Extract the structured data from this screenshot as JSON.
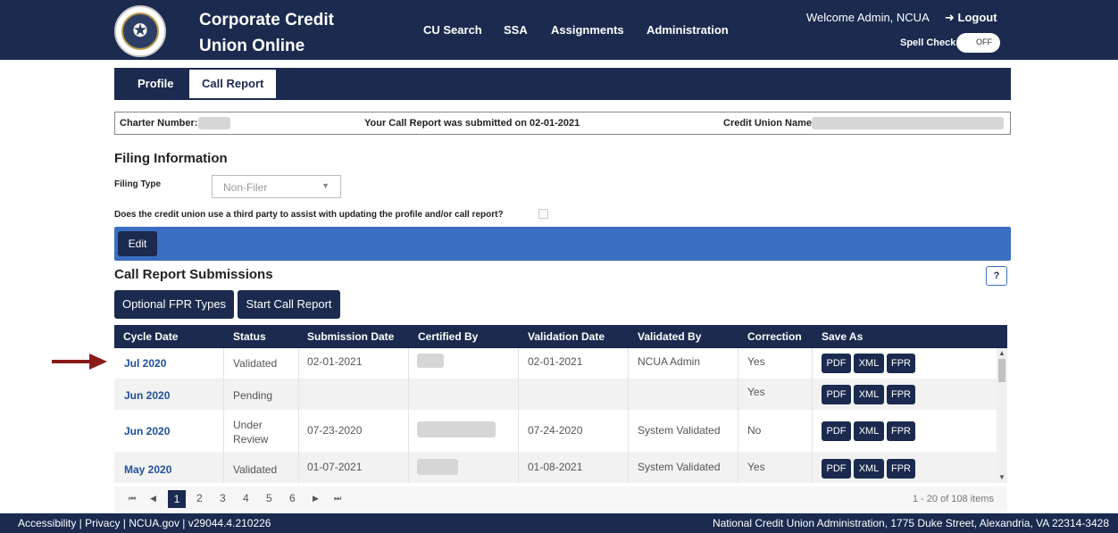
{
  "header": {
    "title_line1": "Corporate Credit",
    "title_line2": "Union Online",
    "nav": [
      "CU Search",
      "SSA",
      "Assignments",
      "Administration"
    ],
    "welcome": "Welcome Admin, NCUA",
    "logout": "Logout",
    "spell_check_label": "Spell Check",
    "spell_check_state": "OFF"
  },
  "tabs": [
    "Profile",
    "Call Report"
  ],
  "info": {
    "charter_label": "Charter Number:",
    "submitted_text": "Your Call Report was submitted on 02-01-2021",
    "cu_name_label": "Credit Union Name:"
  },
  "filing": {
    "heading": "Filing Information",
    "type_label": "Filing Type",
    "type_value": "Non-Filer",
    "third_party_question": "Does the credit union use a third party to assist with updating the profile and/or call report?",
    "edit_label": "Edit"
  },
  "submissions": {
    "heading": "Call Report Submissions",
    "help_label": "?",
    "optional_fpr_label": "Optional FPR Types",
    "start_label": "Start Call Report",
    "columns": [
      "Cycle Date",
      "Status",
      "Submission Date",
      "Certified By",
      "Validation Date",
      "Validated By",
      "Correction",
      "Save As"
    ],
    "save_buttons": [
      "PDF",
      "XML",
      "FPR"
    ],
    "rows": [
      {
        "cycle": "Jul 2020",
        "status": "Validated",
        "submission": "02-01-2021",
        "validation": "02-01-2021",
        "validated_by": "NCUA Admin",
        "correction": "Yes"
      },
      {
        "cycle": "Jun 2020",
        "status": "Pending",
        "submission": "",
        "validation": "",
        "validated_by": "",
        "correction": "Yes"
      },
      {
        "cycle": "Jun 2020",
        "status": "Under Review",
        "submission": "07-23-2020",
        "validation": "07-24-2020",
        "validated_by": "System Validated",
        "correction": "No"
      },
      {
        "cycle": "May 2020",
        "status": "Validated",
        "submission": "01-07-2021",
        "validation": "01-08-2021",
        "validated_by": "System Validated",
        "correction": "Yes"
      }
    ]
  },
  "pager": {
    "first": "⏮",
    "prev": "◀",
    "pages": [
      "1",
      "2",
      "3",
      "4",
      "5",
      "6"
    ],
    "next": "▶",
    "last": "⏭",
    "info": "1 - 20 of 108 items"
  },
  "footer": {
    "left": "Accessibility | Privacy | NCUA.gov | v29044.4.210226",
    "right": "National Credit Union Administration, 1775 Duke Street, Alexandria, VA 22314-3428"
  },
  "colors": {
    "navy": "#1b2a4e",
    "accent_blue": "#3a6ec0",
    "arrow_red": "#8b1a1a"
  }
}
